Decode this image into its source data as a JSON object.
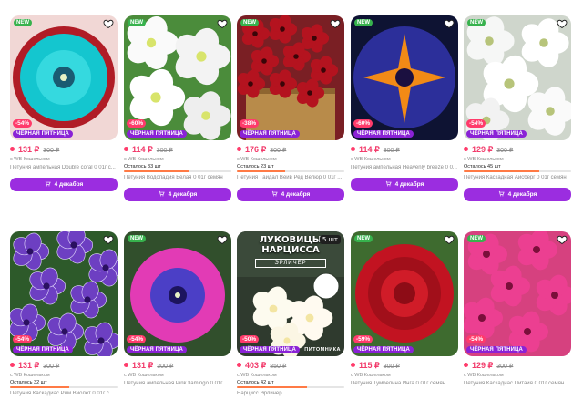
{
  "colors": {
    "accent": "#9b2de0",
    "price": "#f23b6b",
    "new_badge": "#37b24d",
    "black_friday": "#8a22d6",
    "discount": "#ff3b6b"
  },
  "cards": [
    {
      "new": "NEW",
      "discount": "-54%",
      "black_friday": "ЧЁРНАЯ ПЯТНИЦА",
      "price": "131 ₽",
      "old_price": "300 ₽",
      "seller": "с WB Кошельком",
      "left": "",
      "left_fraction": 0,
      "title": "Петуния ампельная Double coral 0 01г с...",
      "cart": "4 декабря",
      "art": "coral"
    },
    {
      "new": "NEW",
      "discount": "-60%",
      "black_friday": "ЧЁРНАЯ ПЯТНИЦА",
      "price": "114 ₽",
      "old_price": "300 ₽",
      "seller": "с WB Кошельком",
      "left": "Осталось 33 шт",
      "left_fraction": 0.6,
      "title": "Петуния Водопадия Белая 0 01г семян",
      "cart": "4 декабря",
      "art": "white"
    },
    {
      "new": "NEW",
      "discount": "-38%",
      "black_friday": "ЧЁРНАЯ ПЯТНИЦА",
      "price": "176 ₽",
      "old_price": "300 ₽",
      "seller": "с WB Кошельком",
      "left": "Осталось 23 шт",
      "left_fraction": 0.45,
      "title": "Петуния Тайдал Вейв Ред Велюр 0 01г ...",
      "cart": "4 декабря",
      "art": "red-pot"
    },
    {
      "new": "NEW",
      "discount": "-60%",
      "black_friday": "ЧЁРНАЯ ПЯТНИЦА",
      "price": "114 ₽",
      "old_price": "300 ₽",
      "seller": "с WB Кошельком",
      "left": "",
      "left_fraction": 0,
      "title": "Петуния ампельная Heavenly breeze 0 0...",
      "cart": "4 декабря",
      "art": "blue-star"
    },
    {
      "new": "NEW",
      "discount": "-54%",
      "black_friday": "ЧЁРНАЯ ПЯТНИЦА",
      "price": "129 ₽",
      "old_price": "300 ₽",
      "seller": "с WB Кошельком",
      "left": "Осталось 45 шт",
      "left_fraction": 0.7,
      "title": "Петуния Каскадная Айсберг 0 01г семян",
      "cart": "4 декабря",
      "art": "white-soft"
    },
    {
      "new": "",
      "discount": "-54%",
      "black_friday": "ЧЁРНАЯ ПЯТНИЦА",
      "price": "131 ₽",
      "old_price": "300 ₽",
      "seller": "с WB Кошельком",
      "left": "Осталось 32 шт",
      "left_fraction": 0.55,
      "title": "Петуния Каскадиас Рим Виолет 0 01г с...",
      "cart": "",
      "art": "violet"
    },
    {
      "new": "NEW",
      "discount": "-54%",
      "black_friday": "ЧЁРНАЯ ПЯТНИЦА",
      "price": "131 ₽",
      "old_price": "300 ₽",
      "seller": "с WB Кошельком",
      "left": "",
      "left_fraction": 0,
      "title": "Петуния ампельная Pink flamingo 0 01г ...",
      "cart": "",
      "art": "pink-blue"
    },
    {
      "new": "",
      "discount": "-50%",
      "black_friday": "ЧЁРНАЯ ПЯТНИЦА",
      "price": "403 ₽",
      "old_price": "850 ₽",
      "seller": "с WB Кошельком",
      "left": "Осталось 42 шт",
      "left_fraction": 0.65,
      "title": "Нарцисс Эрличер",
      "cart": "",
      "art": "narcissus",
      "promo_title": "ЛУКОВИЦЫ НАРЦИССА",
      "promo_count": "5 шт",
      "promo_sub": "ЭРЛИЧЕР",
      "promo_bottom": "ПИТОМНИКА"
    },
    {
      "new": "NEW",
      "discount": "-59%",
      "black_friday": "ЧЁРНАЯ ПЯТНИЦА",
      "price": "115 ₽",
      "old_price": "300 ₽",
      "seller": "с WB Кошельком",
      "left": "",
      "left_fraction": 0,
      "title": "Петуния Тумбелина Инга 0 01г семян",
      "cart": "",
      "art": "red-double"
    },
    {
      "new": "NEW",
      "discount": "-54%",
      "black_friday": "ЧЁРНАЯ ПЯТНИЦА",
      "price": "129 ₽",
      "old_price": "300 ₽",
      "seller": "с WB Кошельком",
      "left": "",
      "left_fraction": 0,
      "title": "Петуния Каскадиас Питайя 0 01г семян",
      "cart": "",
      "art": "magenta"
    }
  ]
}
